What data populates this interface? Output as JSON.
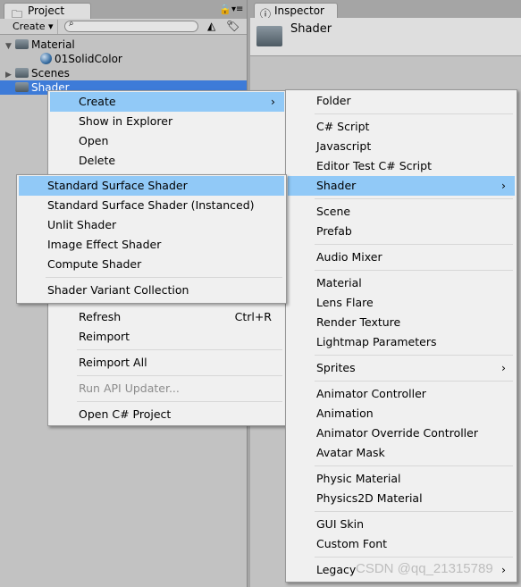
{
  "project": {
    "tab": "Project",
    "create": "Create ▾",
    "tree": [
      {
        "label": "Material",
        "icon": "folder-icon",
        "expand": "▼"
      },
      {
        "label": "01SolidColor",
        "icon": "material-ball-icon",
        "expand": ""
      },
      {
        "label": "Scenes",
        "icon": "folder-icon",
        "expand": "▶"
      },
      {
        "label": "Shader",
        "icon": "folder-icon",
        "expand": "",
        "selected": true
      }
    ]
  },
  "inspector": {
    "tab": "Inspector",
    "title": "Shader"
  },
  "context_menu": {
    "items": [
      {
        "label": "Create",
        "submenu": true,
        "highlighted": true
      },
      {
        "label": "Show in Explorer"
      },
      {
        "label": "Open"
      },
      {
        "label": "Delete"
      },
      {
        "gap": true
      },
      {
        "label": "Refresh",
        "shortcut": "Ctrl+R"
      },
      {
        "label": "Reimport"
      },
      {
        "sep": true
      },
      {
        "label": "Reimport All"
      },
      {
        "sep": true
      },
      {
        "label": "Run API Updater...",
        "disabled": true
      },
      {
        "sep": true
      },
      {
        "label": "Open C# Project"
      }
    ]
  },
  "create_menu": {
    "items": [
      {
        "label": "Folder"
      },
      {
        "sep": true
      },
      {
        "label": "C# Script"
      },
      {
        "label": "Javascript"
      },
      {
        "label": "Editor Test C# Script"
      },
      {
        "label": "Shader",
        "submenu": true,
        "highlighted": true
      },
      {
        "sep": true
      },
      {
        "label": "Scene"
      },
      {
        "label": "Prefab"
      },
      {
        "sep": true
      },
      {
        "label": "Audio Mixer"
      },
      {
        "sep": true
      },
      {
        "label": "Material"
      },
      {
        "label": "Lens Flare"
      },
      {
        "label": "Render Texture"
      },
      {
        "label": "Lightmap Parameters"
      },
      {
        "sep": true
      },
      {
        "label": "Sprites",
        "submenu": true
      },
      {
        "sep": true
      },
      {
        "label": "Animator Controller"
      },
      {
        "label": "Animation"
      },
      {
        "label": "Animator Override Controller"
      },
      {
        "label": "Avatar Mask"
      },
      {
        "sep": true
      },
      {
        "label": "Physic Material"
      },
      {
        "label": "Physics2D Material"
      },
      {
        "sep": true
      },
      {
        "label": "GUI Skin"
      },
      {
        "label": "Custom Font"
      },
      {
        "sep": true
      },
      {
        "label": "Legacy",
        "submenu": true
      }
    ]
  },
  "shader_menu": {
    "items": [
      {
        "label": "Standard Surface Shader",
        "highlighted": true
      },
      {
        "label": "Standard Surface Shader (Instanced)"
      },
      {
        "label": "Unlit Shader"
      },
      {
        "label": "Image Effect Shader"
      },
      {
        "label": "Compute Shader"
      },
      {
        "sep": true
      },
      {
        "label": "Shader Variant Collection"
      }
    ]
  },
  "watermark": "CSDN @qq_21315789",
  "colors": {
    "highlight": "#91c9f7",
    "selection": "#3d7bd8",
    "menu_bg": "#f0f0f0"
  }
}
